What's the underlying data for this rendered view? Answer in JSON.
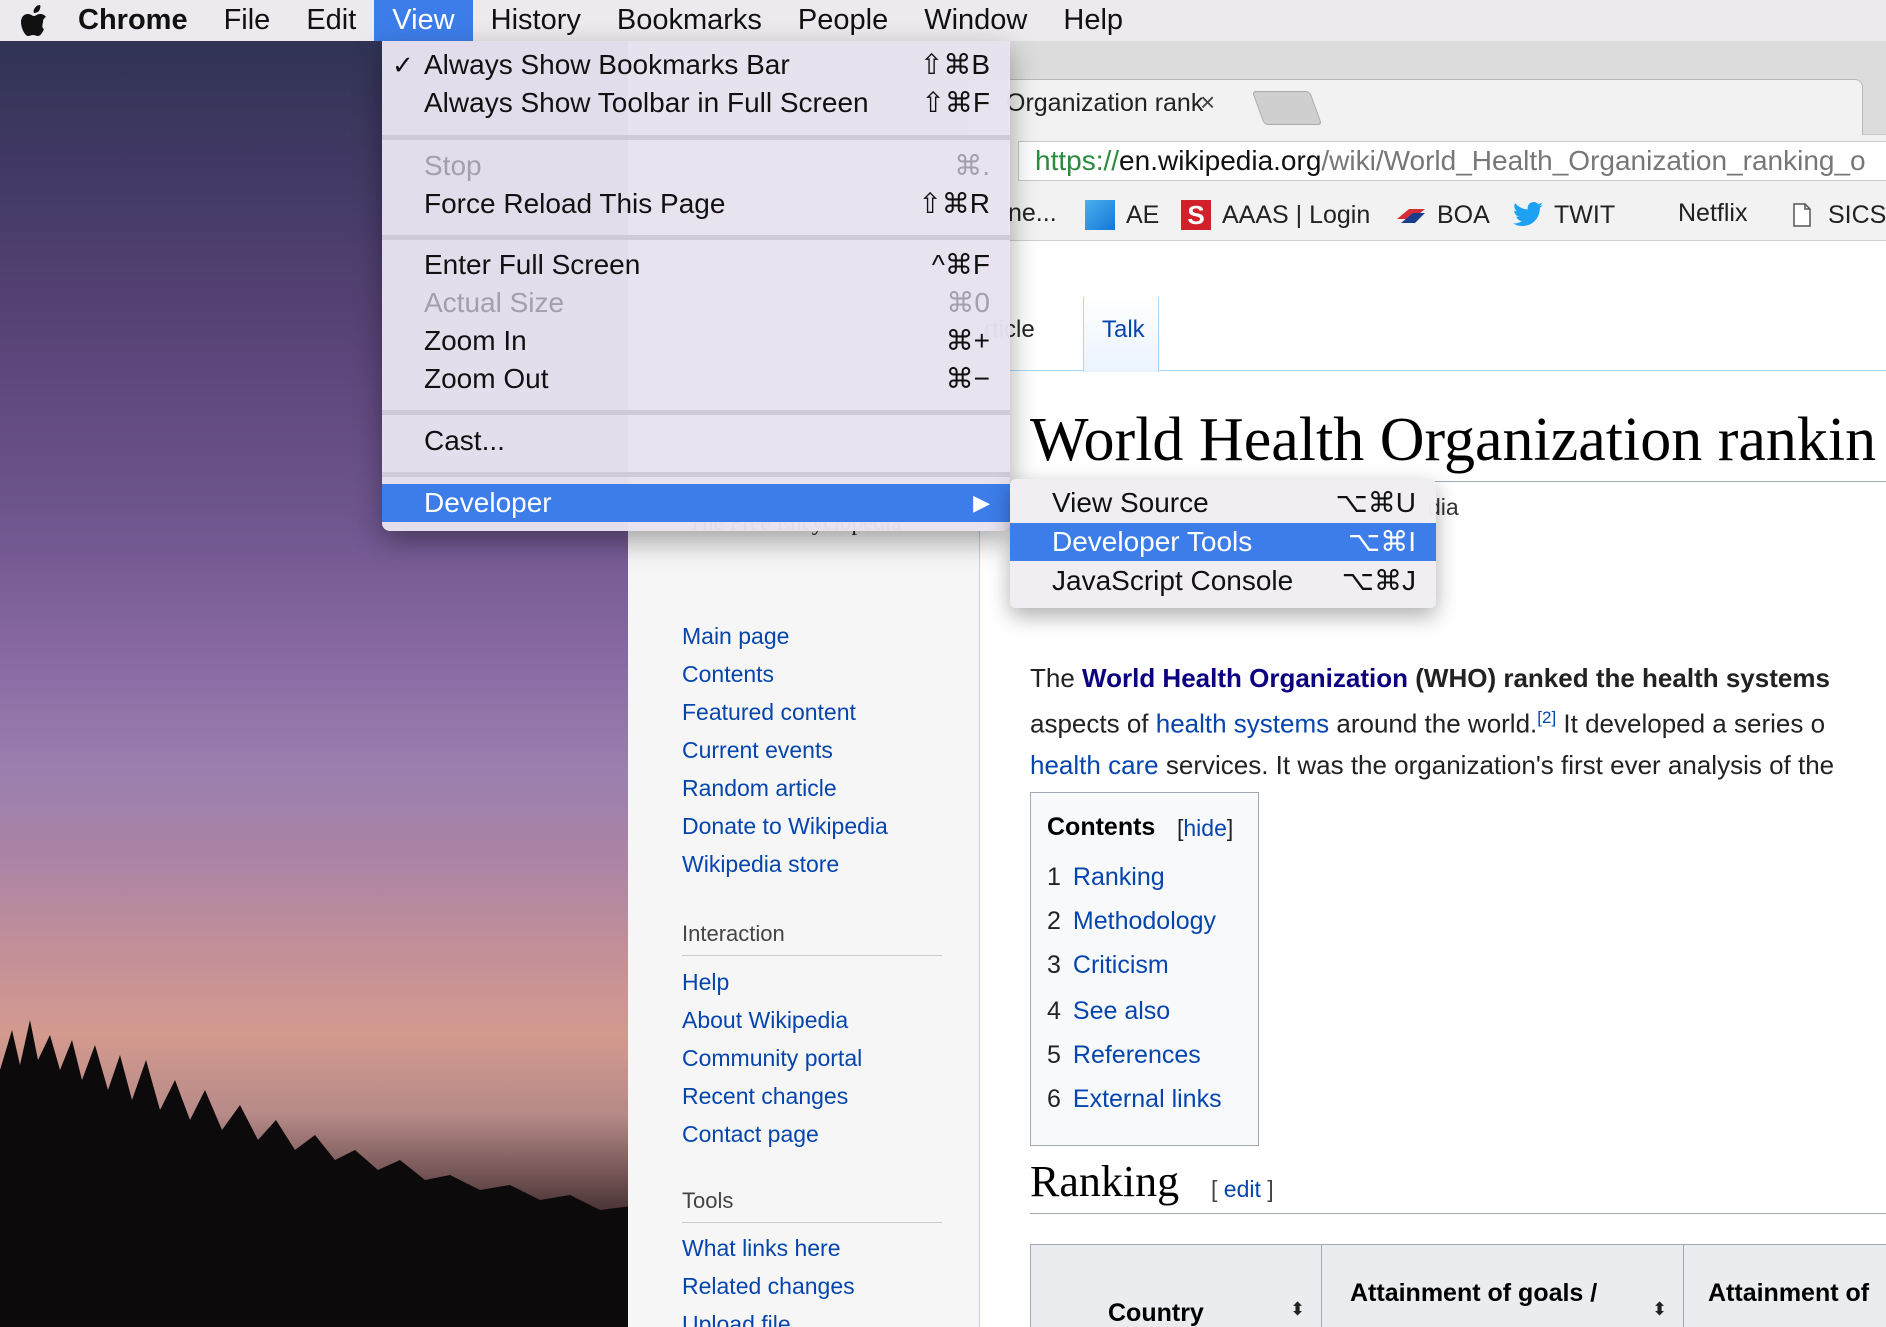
{
  "menubar": {
    "app": "Chrome",
    "items": [
      "File",
      "Edit",
      "View",
      "History",
      "Bookmarks",
      "People",
      "Window",
      "Help"
    ],
    "active": "View"
  },
  "view_menu": {
    "items": [
      {
        "label": "Always Show Bookmarks Bar",
        "shortcut": "⇧⌘B",
        "checked": true,
        "enabled": true
      },
      {
        "label": "Always Show Toolbar in Full Screen",
        "shortcut": "⇧⌘F",
        "enabled": true
      },
      {
        "label": "Stop",
        "shortcut": "⌘.",
        "enabled": false
      },
      {
        "label": "Force Reload This Page",
        "shortcut": "⇧⌘R",
        "enabled": true
      },
      {
        "label": "Enter Full Screen",
        "shortcut": "^⌘F",
        "enabled": true
      },
      {
        "label": "Actual Size",
        "shortcut": "⌘0",
        "enabled": false
      },
      {
        "label": "Zoom In",
        "shortcut": "⌘+",
        "enabled": true
      },
      {
        "label": "Zoom Out",
        "shortcut": "⌘−",
        "enabled": true
      },
      {
        "label": "Cast...",
        "shortcut": "",
        "enabled": true
      },
      {
        "label": "Developer",
        "shortcut": "▶",
        "enabled": true,
        "highlighted": true
      }
    ]
  },
  "developer_menu": {
    "items": [
      {
        "label": "View Source",
        "shortcut": "⌥⌘U"
      },
      {
        "label": "Developer Tools",
        "shortcut": "⌥⌘I",
        "highlighted": true
      },
      {
        "label": "JavaScript Console",
        "shortcut": "⌥⌘J"
      }
    ]
  },
  "browser": {
    "tab_title": "Organization rank",
    "url_protocol": "https://",
    "url_host": "en.wikipedia.org",
    "url_path": "/wiki/World_Health_Organization_ranking_o",
    "bookmarks": [
      "ne...",
      "AE",
      "AAAS | Login",
      "BOA",
      "TWIT",
      "Netflix",
      "SICSS"
    ]
  },
  "wiki": {
    "logo_subtitle": "The Free Encyclopedia",
    "nav_links": [
      "Main page",
      "Contents",
      "Featured content",
      "Current events",
      "Random article",
      "Donate to Wikipedia",
      "Wikipedia store"
    ],
    "interaction_header": "Interaction",
    "interaction_links": [
      "Help",
      "About Wikipedia",
      "Community portal",
      "Recent changes",
      "Contact page"
    ],
    "tools_header": "Tools",
    "tools_links": [
      "What links here",
      "Related changes",
      "Upload file"
    ],
    "tab_article": "rticle",
    "tab_talk": "Talk",
    "title": "World Health Organization rankin",
    "from_fragment": "dia",
    "para1": {
      "t1": "The ",
      "link1": "World Health Organization",
      "t2": " (WHO) ",
      "t3": "ranked the health systems"
    },
    "para2": {
      "t1": "aspects of ",
      "link1": "health systems",
      "t2": " around the world.",
      "sup": "[2]",
      "t3": " It developed a series o"
    },
    "para3": {
      "link1": "health care",
      "t2": " services. It was the organization's first ever analysis of the"
    },
    "toc": {
      "title": "Contents",
      "hide_open": "[",
      "hide": "hide",
      "hide_close": "]",
      "items": [
        {
          "num": "1",
          "label": "Ranking"
        },
        {
          "num": "2",
          "label": "Methodology"
        },
        {
          "num": "3",
          "label": "Criticism"
        },
        {
          "num": "4",
          "label": "See also"
        },
        {
          "num": "5",
          "label": "References"
        },
        {
          "num": "6",
          "label": "External links"
        }
      ]
    },
    "section_heading": "Ranking",
    "edit_open": "[ ",
    "edit": "edit",
    "edit_close": " ]",
    "table_headers": [
      "Country",
      "Attainment of goals /",
      "Attainment of"
    ]
  }
}
